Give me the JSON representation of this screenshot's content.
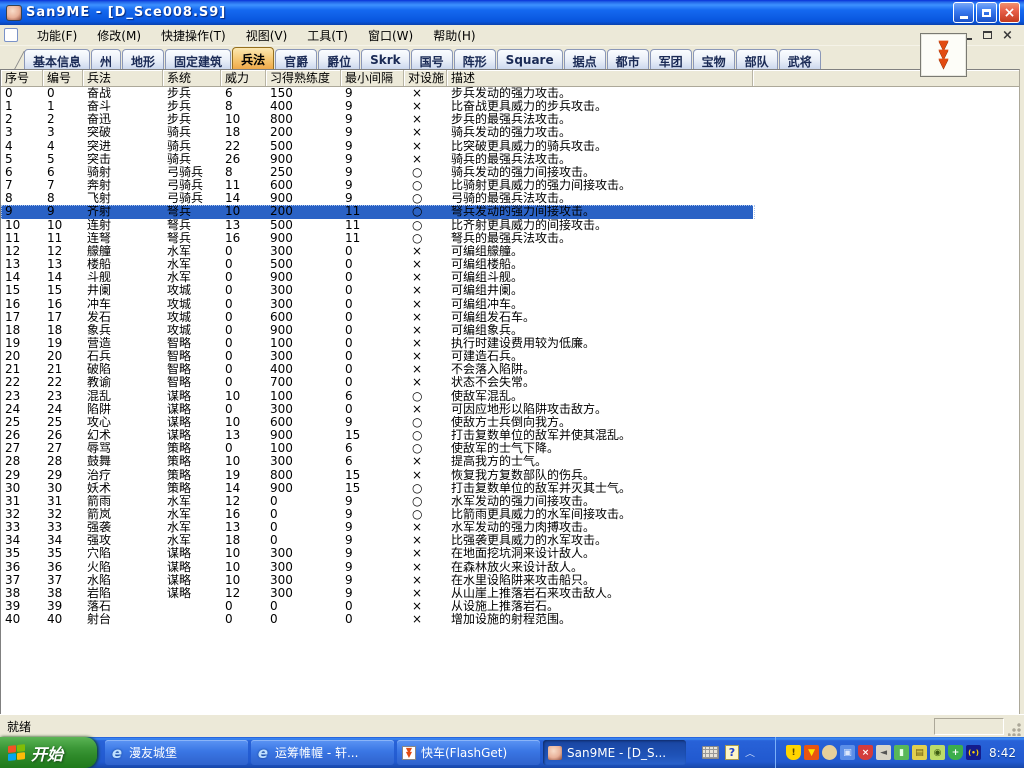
{
  "window": {
    "title": "San9ME - [D_Sce008.S9]"
  },
  "menu": {
    "items": [
      {
        "key": "function",
        "label": "功能(F)"
      },
      {
        "key": "modify",
        "label": "修改(M)"
      },
      {
        "key": "shortcut-actions",
        "label": "快捷操作(T)"
      },
      {
        "key": "view",
        "label": "视图(V)"
      },
      {
        "key": "tools",
        "label": "工具(T)"
      },
      {
        "key": "window",
        "label": "窗口(W)"
      },
      {
        "key": "help",
        "label": "帮助(H)"
      }
    ]
  },
  "tabs": {
    "active": "兵法",
    "items": [
      {
        "key": "basic-info",
        "label": "基本信息"
      },
      {
        "key": "province",
        "label": "州"
      },
      {
        "key": "terrain",
        "label": "地形"
      },
      {
        "key": "fixed-buildings",
        "label": "固定建筑"
      },
      {
        "key": "tactics",
        "label": "兵法"
      },
      {
        "key": "official-rank",
        "label": "官爵"
      },
      {
        "key": "nobility",
        "label": "爵位"
      },
      {
        "key": "skrk",
        "label": "Skrk"
      },
      {
        "key": "country-title",
        "label": "国号"
      },
      {
        "key": "formation",
        "label": "阵形"
      },
      {
        "key": "square",
        "label": "Square"
      },
      {
        "key": "base",
        "label": "据点"
      },
      {
        "key": "city",
        "label": "都市"
      },
      {
        "key": "corps",
        "label": "军团"
      },
      {
        "key": "treasure",
        "label": "宝物"
      },
      {
        "key": "troops",
        "label": "部队"
      },
      {
        "key": "officers",
        "label": "武将"
      }
    ]
  },
  "table": {
    "columns": [
      "序号",
      "编号",
      "兵法",
      "系统",
      "威力",
      "习得熟练度",
      "最小间隔",
      "对设施",
      "描述"
    ],
    "selected_index": 9,
    "rows": [
      [
        "0",
        "0",
        "奋战",
        "步兵",
        "6",
        "150",
        "9",
        "×",
        "步兵发动的强力攻击。"
      ],
      [
        "1",
        "1",
        "奋斗",
        "步兵",
        "8",
        "400",
        "9",
        "×",
        "比奋战更具威力的步兵攻击。"
      ],
      [
        "2",
        "2",
        "奋迅",
        "步兵",
        "10",
        "800",
        "9",
        "×",
        "步兵的最强兵法攻击。"
      ],
      [
        "3",
        "3",
        "突破",
        "骑兵",
        "18",
        "200",
        "9",
        "×",
        "骑兵发动的强力攻击。"
      ],
      [
        "4",
        "4",
        "突进",
        "骑兵",
        "22",
        "500",
        "9",
        "×",
        "比突破更具威力的骑兵攻击。"
      ],
      [
        "5",
        "5",
        "突击",
        "骑兵",
        "26",
        "900",
        "9",
        "×",
        "骑兵的最强兵法攻击。"
      ],
      [
        "6",
        "6",
        "骑射",
        "弓骑兵",
        "8",
        "250",
        "9",
        "○",
        "骑兵发动的强力间接攻击。"
      ],
      [
        "7",
        "7",
        "奔射",
        "弓骑兵",
        "11",
        "600",
        "9",
        "○",
        "比骑射更具威力的强力间接攻击。"
      ],
      [
        "8",
        "8",
        "飞射",
        "弓骑兵",
        "14",
        "900",
        "9",
        "○",
        "弓骑的最强兵法攻击。"
      ],
      [
        "9",
        "9",
        "齐射",
        "弩兵",
        "10",
        "200",
        "11",
        "○",
        "弩兵发动的强力间接攻击。"
      ],
      [
        "10",
        "10",
        "连射",
        "弩兵",
        "13",
        "500",
        "11",
        "○",
        "比齐射更具威力的间接攻击。"
      ],
      [
        "11",
        "11",
        "连弩",
        "弩兵",
        "16",
        "900",
        "11",
        "○",
        "弩兵的最强兵法攻击。"
      ],
      [
        "12",
        "12",
        "艨艟",
        "水军",
        "0",
        "300",
        "0",
        "×",
        "可编组艨艟。"
      ],
      [
        "13",
        "13",
        "楼船",
        "水军",
        "0",
        "500",
        "0",
        "×",
        "可编组楼船。"
      ],
      [
        "14",
        "14",
        "斗舰",
        "水军",
        "0",
        "900",
        "0",
        "×",
        "可编组斗舰。"
      ],
      [
        "15",
        "15",
        "井阑",
        "攻城",
        "0",
        "300",
        "0",
        "×",
        "可编组井阑。"
      ],
      [
        "16",
        "16",
        "冲车",
        "攻城",
        "0",
        "300",
        "0",
        "×",
        "可编组冲车。"
      ],
      [
        "17",
        "17",
        "发石",
        "攻城",
        "0",
        "600",
        "0",
        "×",
        "可编组发石车。"
      ],
      [
        "18",
        "18",
        "象兵",
        "攻城",
        "0",
        "900",
        "0",
        "×",
        "可编组象兵。"
      ],
      [
        "19",
        "19",
        "营造",
        "智略",
        "0",
        "100",
        "0",
        "×",
        "执行时建设费用较为低廉。"
      ],
      [
        "20",
        "20",
        "石兵",
        "智略",
        "0",
        "300",
        "0",
        "×",
        "可建造石兵。"
      ],
      [
        "21",
        "21",
        "破陷",
        "智略",
        "0",
        "400",
        "0",
        "×",
        "不会落入陷阱。"
      ],
      [
        "22",
        "22",
        "教谕",
        "智略",
        "0",
        "700",
        "0",
        "×",
        "状态不会失常。"
      ],
      [
        "23",
        "23",
        "混乱",
        "谋略",
        "10",
        "100",
        "6",
        "○",
        "使敌军混乱。"
      ],
      [
        "24",
        "24",
        "陷阱",
        "谋略",
        "0",
        "300",
        "0",
        "×",
        "可因应地形以陷阱攻击敌方。"
      ],
      [
        "25",
        "25",
        "攻心",
        "谋略",
        "10",
        "600",
        "9",
        "○",
        "使敌方士兵倒向我方。"
      ],
      [
        "26",
        "26",
        "幻术",
        "谋略",
        "13",
        "900",
        "15",
        "○",
        "打击复数单位的敌军并使其混乱。"
      ],
      [
        "27",
        "27",
        "辱骂",
        "策略",
        "0",
        "100",
        "6",
        "○",
        "使敌军的士气下降。"
      ],
      [
        "28",
        "28",
        "鼓舞",
        "策略",
        "10",
        "300",
        "6",
        "×",
        "提高我方的士气。"
      ],
      [
        "29",
        "29",
        "治疗",
        "策略",
        "19",
        "800",
        "15",
        "×",
        "恢复我方复数部队的伤兵。"
      ],
      [
        "30",
        "30",
        "妖术",
        "策略",
        "14",
        "900",
        "15",
        "○",
        "打击复数单位的敌军并灭其士气。"
      ],
      [
        "31",
        "31",
        "箭雨",
        "水军",
        "12",
        "0",
        "9",
        "○",
        "水军发动的强力间接攻击。"
      ],
      [
        "32",
        "32",
        "箭岚",
        "水军",
        "16",
        "0",
        "9",
        "○",
        "比箭雨更具威力的水军间接攻击。"
      ],
      [
        "33",
        "33",
        "强袭",
        "水军",
        "13",
        "0",
        "9",
        "×",
        "水军发动的强力肉搏攻击。"
      ],
      [
        "34",
        "34",
        "强攻",
        "水军",
        "18",
        "0",
        "9",
        "×",
        "比强袭更具威力的水军攻击。"
      ],
      [
        "35",
        "35",
        "穴陷",
        "谋略",
        "10",
        "300",
        "9",
        "×",
        "在地面挖坑洞来设计敌人。"
      ],
      [
        "36",
        "36",
        "火陷",
        "谋略",
        "10",
        "300",
        "9",
        "×",
        "在森林放火来设计敌人。"
      ],
      [
        "37",
        "37",
        "水陷",
        "谋略",
        "10",
        "300",
        "9",
        "×",
        "在水里设陷阱来攻击船只。"
      ],
      [
        "38",
        "38",
        "岩陷",
        "谋略",
        "12",
        "300",
        "9",
        "×",
        "从山崖上推落岩石来攻击敌人。"
      ],
      [
        "39",
        "39",
        "落石",
        "",
        "0",
        "0",
        "0",
        "×",
        "从设施上推落岩石。"
      ],
      [
        "40",
        "40",
        "射台",
        "",
        "0",
        "0",
        "0",
        "×",
        "增加设施的射程范围。"
      ]
    ]
  },
  "statusbar": {
    "text": "就绪"
  },
  "taskbar": {
    "start_label": "开始",
    "tasks": [
      {
        "label": "漫友城堡",
        "icon": "ie",
        "active": false
      },
      {
        "label": "运筹帷幄 - 轩...",
        "icon": "ie",
        "active": false
      },
      {
        "label": "快车(FlashGet)",
        "icon": "flashget",
        "active": false
      },
      {
        "label": "San9ME - [D_S...",
        "icon": "avatar",
        "active": true
      }
    ],
    "help_glyph": "?",
    "expand_glyph": "︿",
    "tray_icons": [
      {
        "name": "security-alert-icon",
        "glyph": "!",
        "bg": "#ffd400",
        "fg": "#5a4500",
        "shape": "shield"
      },
      {
        "name": "flashget-tray-icon",
        "glyph": "▼",
        "bg": "#e85510",
        "fg": "#ffe400",
        "shape": "square"
      },
      {
        "name": "pet-antivirus-icon",
        "glyph": "",
        "bg": "#e7cf9a",
        "fg": "#7a5b2a",
        "shape": "round"
      },
      {
        "name": "network-places-icon",
        "glyph": "▣",
        "bg": "#5b8ee8",
        "fg": "#dce8fc",
        "shape": "square"
      },
      {
        "name": "security-center-icon",
        "glyph": "×",
        "bg": "#d43c3c",
        "fg": "#ffffff",
        "shape": "shield"
      },
      {
        "name": "volume-icon",
        "glyph": "◄",
        "bg": "#d8d4c8",
        "fg": "#555555",
        "shape": "square"
      },
      {
        "name": "usb-device-icon",
        "glyph": "▮",
        "bg": "#59b859",
        "fg": "#e8ffe8",
        "shape": "square"
      },
      {
        "name": "memory-cards-icon",
        "glyph": "▤",
        "bg": "#e3cf4e",
        "fg": "#6a5a10",
        "shape": "square"
      },
      {
        "name": "monitor-eye-icon",
        "glyph": "◉",
        "bg": "#bcdc6a",
        "fg": "#3a5a10",
        "shape": "square"
      },
      {
        "name": "antivirus-shield-icon",
        "glyph": "+",
        "bg": "#3cae4c",
        "fg": "#ffffff",
        "shape": "shield"
      },
      {
        "name": "wireless-signal-icon",
        "glyph": "(•)",
        "bg": "#141c8c",
        "fg": "#ffd400",
        "shape": "square"
      }
    ],
    "clock": "8:42"
  },
  "colors": {
    "selection": "#2a62c5",
    "active_tab": "#f2b759",
    "taskbar_blue": "#2157d6",
    "start_green": "#2f8a2a",
    "statusbar_bg": "#ece9d8"
  }
}
